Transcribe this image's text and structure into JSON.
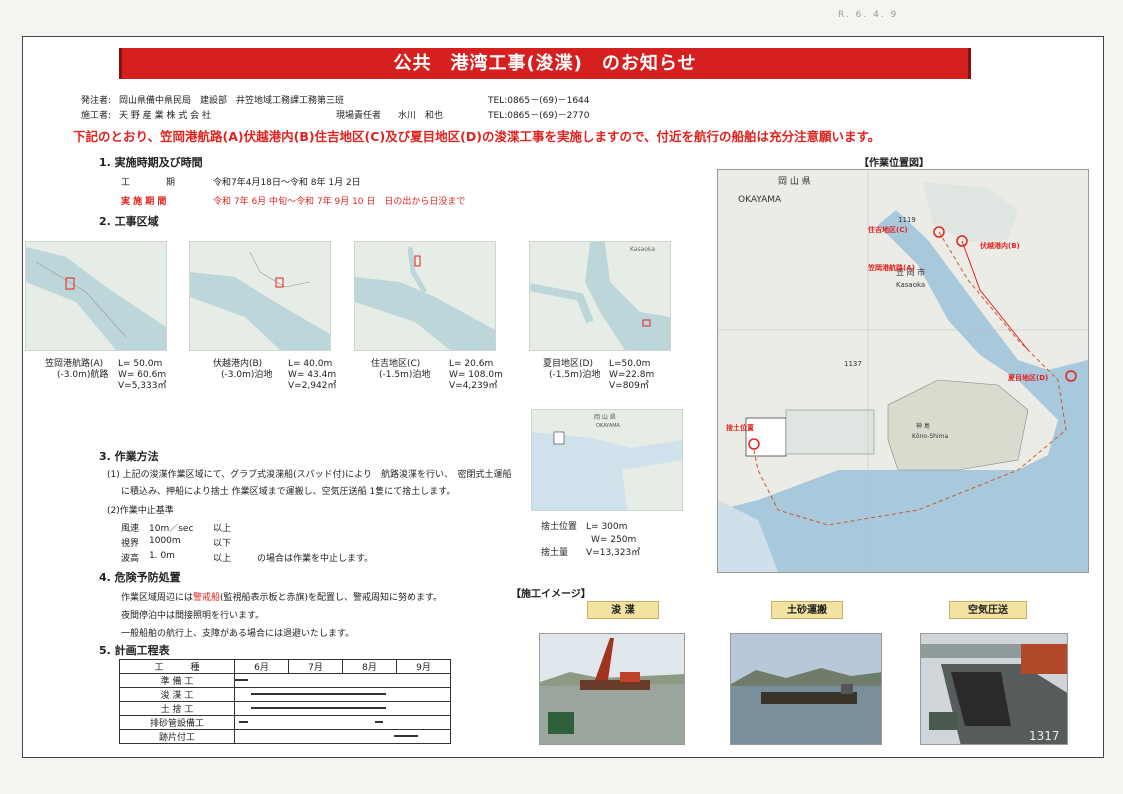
{
  "stamp": "R. 6. 4. 9",
  "title": "公共　港湾工事(浚渫)　のお知らせ",
  "header": {
    "orderer_label": "発注者:",
    "orderer": "岡山県備中県民局　建設部　井笠地域工務課工務第三班",
    "orderer_tel": "TEL:0865－(69)－1644",
    "contractor_label": "施工者:",
    "contractor": "天 野 産 業 株 式 会 社",
    "site_manager_label": "現場責任者",
    "site_manager": "水川　和也",
    "contractor_tel": "TEL:0865－(69)－2770"
  },
  "lead": "下記のとおり、笠岡港航路(A)伏越港内(B)住吉地区(C)及び夏目地区(D)の浚渫工事を実施しますので、付近を航行の船舶は充分注意願います。",
  "section1": {
    "heading": "1. 実施時期及び時間",
    "work_label": "工　　期",
    "work_value": "令和7年4月18日～令和 8年 1月  2日",
    "impl_label": "実 施 期 間",
    "impl_value": "令和 7年 6月 中旬～令和 7年 9月 10 日　日の出から日没まで"
  },
  "section2": {
    "heading": "2. 工事区域",
    "areas": [
      {
        "name": "笠岡港航路(A)",
        "depth": "(-3.0m)航路",
        "l": "L= 50.0m",
        "w": "W= 60.6m",
        "v": "V=5,333㎥"
      },
      {
        "name": "伏越港内(B)",
        "depth": "(-3.0m)泊地",
        "l": "L=  40.0m",
        "w": "W= 43.4m",
        "v": "V=2,942㎥"
      },
      {
        "name": "住吉地区(C)",
        "depth": "(-1.5m)泊地",
        "l": "L=  20.6m",
        "w": "W= 108.0m",
        "v": "V=4,239㎥"
      },
      {
        "name": "夏目地区(D)",
        "depth": "(-1.5m)泊地",
        "l": "L=50.0m",
        "w": "W=22.8m",
        "v": "V=809㎥"
      }
    ],
    "thumb4_label": "Kasaoka"
  },
  "dump": {
    "map_label1": "岡 山 県",
    "map_label2": "OKAYAMA",
    "pos_label": "捨土位置",
    "l": "L=  300m",
    "w": "W=  250m",
    "amount_label": "捨土量",
    "v": "V=13,323㎥"
  },
  "section3": {
    "heading": "3. 作業方法",
    "p1": "(1) 上記の浚渫作業区域にて、グラブ式浚渫船(スパッド付)により　航路浚渫を行い、　密閉式土運船",
    "p1b": "に積込み、押船により捨土 作業区域まで運搬し、空気圧送船 1隻にて捨土します。",
    "p2": "(2)作業中止基準",
    "criteria": [
      {
        "k": "風速",
        "v": "10m／sec",
        "c": "以上"
      },
      {
        "k": "視界",
        "v": "1000m",
        "c": "以下"
      },
      {
        "k": "波高",
        "v": "1. 0m",
        "c": "以上"
      }
    ],
    "stop_note": "の場合は作業を中止します。"
  },
  "section4": {
    "heading": "4. 危険予防処置",
    "line1_pre": "作業区域周辺には",
    "line1_red": "警戒船",
    "line1_post": "(監視船表示板と赤旗)を配置し、警戒周知に努めます。",
    "line2": "夜間停泊中は間接照明を行います。",
    "line3": "一般船舶の航行上、支障がある場合には退避いたします。"
  },
  "section5": {
    "heading": "5. 計画工程表",
    "col_task": "工　　　種",
    "months": [
      "6月",
      "7月",
      "8月",
      "9月"
    ],
    "rows": [
      {
        "task": "準 備 工",
        "start": 0.0,
        "end": 0.25
      },
      {
        "task": "浚 渫 工",
        "start": 0.3,
        "end": 2.8
      },
      {
        "task": "土 捨 工",
        "start": 0.3,
        "end": 2.8
      },
      {
        "task": "排砂管設備工",
        "start": 0.08,
        "end": 0.25
      },
      {
        "task": "跡片付工",
        "start": 2.95,
        "end": 3.4
      }
    ],
    "row5_extra": {
      "start": 2.6,
      "end": 2.75
    }
  },
  "images": {
    "heading": "【施工イメージ】",
    "labels": [
      "浚 渫",
      "土砂運搬",
      "空気圧送"
    ],
    "photo3_text": "1317"
  },
  "location": {
    "heading": "【作業位置図】",
    "map_okayama": "OKAYAMA",
    "map_pref": "岡 山 県",
    "map_city": "笠 岡 市",
    "map_kasaoka": "Kasaoka",
    "map_1119": "1119",
    "map_1137": "1137",
    "map_konoshima": "Kōno-Shima",
    "map_konoshima_jp": "神 島",
    "label_c": "住吉地区(C)",
    "label_b": "伏越港内(B)",
    "label_a": "笠岡港航路(A)",
    "label_d": "夏目地区(D)",
    "label_dump": "捨土位置"
  },
  "colors": {
    "banner": "#d61f1f",
    "accent_red": "#e0231f",
    "sea": "#a8c8dc",
    "land": "#e9ece2"
  }
}
